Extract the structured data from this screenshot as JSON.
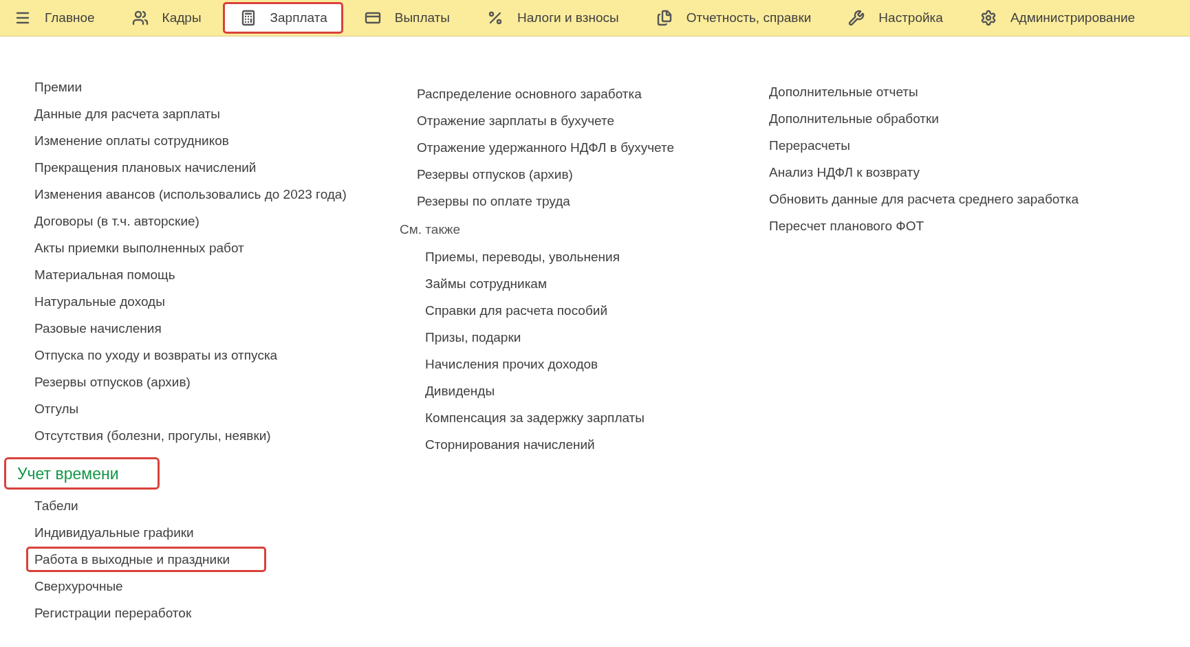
{
  "menu_bar": {
    "tabs": [
      {
        "label": "Главное",
        "selected": false,
        "highlighted": false
      },
      {
        "label": "Кадры",
        "selected": false,
        "highlighted": false
      },
      {
        "label": "Зарплата",
        "selected": true,
        "highlighted": true
      },
      {
        "label": "Выплаты",
        "selected": false,
        "highlighted": false
      },
      {
        "label": "Налоги и взносы",
        "selected": false,
        "highlighted": false
      },
      {
        "label": "Отчетность, справки",
        "selected": false,
        "highlighted": false
      },
      {
        "label": "Настройка",
        "selected": false,
        "highlighted": false
      },
      {
        "label": "Администрирование",
        "selected": false,
        "highlighted": false
      }
    ]
  },
  "columns": [
    {
      "groups": [
        {
          "items": [
            {
              "label": "Премии",
              "highlighted": false
            },
            {
              "label": "Данные для расчета зарплаты",
              "highlighted": false
            },
            {
              "label": "Изменение оплаты сотрудников",
              "highlighted": false
            },
            {
              "label": "Прекращения плановых начислений",
              "highlighted": false
            },
            {
              "label": "Изменения авансов (использовались до 2023 года)",
              "highlighted": false
            },
            {
              "label": "Договоры (в т.ч. авторские)",
              "highlighted": false
            },
            {
              "label": "Акты приемки выполненных работ",
              "highlighted": false
            },
            {
              "label": "Материальная помощь",
              "highlighted": false
            },
            {
              "label": "Натуральные доходы",
              "highlighted": false
            },
            {
              "label": "Разовые начисления",
              "highlighted": false
            },
            {
              "label": "Отпуска по уходу и возвраты из отпуска",
              "highlighted": false
            },
            {
              "label": "Резервы отпусков (архив)",
              "highlighted": false
            },
            {
              "label": "Отгулы",
              "highlighted": false
            },
            {
              "label": "Отсутствия (болезни, прогулы, неявки)",
              "highlighted": false
            }
          ]
        },
        {
          "title": "Учет времени",
          "kind": "section",
          "highlighted": true,
          "items": [
            {
              "label": "Табели",
              "highlighted": false
            },
            {
              "label": "Индивидуальные графики",
              "highlighted": false
            },
            {
              "label": "Работа в выходные и праздники",
              "highlighted": true
            },
            {
              "label": "Сверхурочные",
              "highlighted": false
            },
            {
              "label": "Регистрации переработок",
              "highlighted": false
            }
          ]
        }
      ]
    },
    {
      "groups": [
        {
          "items": [
            {
              "label": "Распределение основного заработка",
              "highlighted": false
            },
            {
              "label": "Отражение зарплаты в бухучете",
              "highlighted": false
            },
            {
              "label": "Отражение удержанного НДФЛ в бухучете",
              "highlighted": false
            },
            {
              "label": "Резервы отпусков (архив)",
              "highlighted": false
            },
            {
              "label": "Резервы по оплате труда",
              "highlighted": false
            }
          ]
        },
        {
          "title": "См. также",
          "kind": "see_also",
          "highlighted": false,
          "items": [
            {
              "label": "Приемы, переводы, увольнения",
              "highlighted": false
            },
            {
              "label": "Займы сотрудникам",
              "highlighted": false
            },
            {
              "label": "Справки для расчета пособий",
              "highlighted": false
            },
            {
              "label": "Призы, подарки",
              "highlighted": false
            },
            {
              "label": "Начисления прочих доходов",
              "highlighted": false
            },
            {
              "label": "Дивиденды",
              "highlighted": false
            },
            {
              "label": "Компенсация за задержку зарплаты",
              "highlighted": false
            },
            {
              "label": "Сторнирования начислений",
              "highlighted": false
            }
          ]
        }
      ]
    },
    {
      "groups": [
        {
          "items": [
            {
              "label": "Дополнительные отчеты",
              "highlighted": false
            },
            {
              "label": "Дополнительные обработки",
              "highlighted": false
            },
            {
              "label": "Перерасчеты",
              "highlighted": false
            },
            {
              "label": "Анализ НДФЛ к возврату",
              "highlighted": false
            },
            {
              "label": "Обновить данные для расчета среднего заработка",
              "highlighted": false
            },
            {
              "label": "Пересчет планового ФОТ",
              "highlighted": false
            }
          ]
        }
      ]
    }
  ]
}
